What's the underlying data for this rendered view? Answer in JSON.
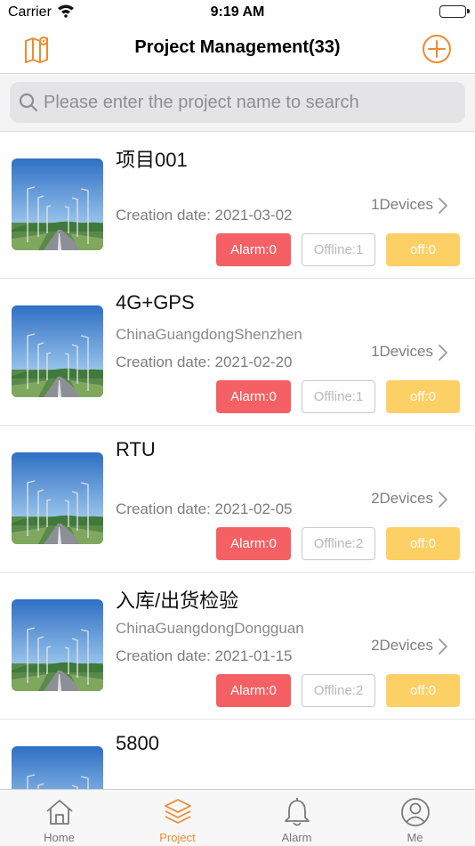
{
  "status_bar": {
    "carrier": "Carrier",
    "time": "9:19 AM"
  },
  "header": {
    "title": "Project Management(33)"
  },
  "search": {
    "placeholder": "Please enter the project name to search"
  },
  "projects": [
    {
      "name": "项目001",
      "location": "",
      "date": "Creation date: 2021-03-02",
      "devices": "1Devices",
      "alarm": "Alarm:0",
      "offline": "Offline:1",
      "off": "off:0"
    },
    {
      "name": "4G+GPS",
      "location": "ChinaGuangdongShenzhen",
      "date": "Creation date: 2021-02-20",
      "devices": "1Devices",
      "alarm": "Alarm:0",
      "offline": "Offline:1",
      "off": "off:0"
    },
    {
      "name": "RTU",
      "location": "",
      "date": "Creation date: 2021-02-05",
      "devices": "2Devices",
      "alarm": "Alarm:0",
      "offline": "Offline:2",
      "off": "off:0"
    },
    {
      "name": "入库/出货检验",
      "location": "ChinaGuangdongDongguan",
      "date": "Creation date: 2021-01-15",
      "devices": "2Devices",
      "alarm": "Alarm:0",
      "offline": "Offline:2",
      "off": "off:0"
    },
    {
      "name": "5800",
      "location": "",
      "date": "",
      "devices": "",
      "alarm": "",
      "offline": "",
      "off": ""
    }
  ],
  "tabs": [
    {
      "label": "Home",
      "icon": "home-icon"
    },
    {
      "label": "Project",
      "icon": "layers-icon"
    },
    {
      "label": "Alarm",
      "icon": "bell-icon"
    },
    {
      "label": "Me",
      "icon": "user-icon"
    }
  ],
  "colors": {
    "accent": "#ee8b2c",
    "alarm": "#f56064",
    "off": "#fdd066"
  }
}
